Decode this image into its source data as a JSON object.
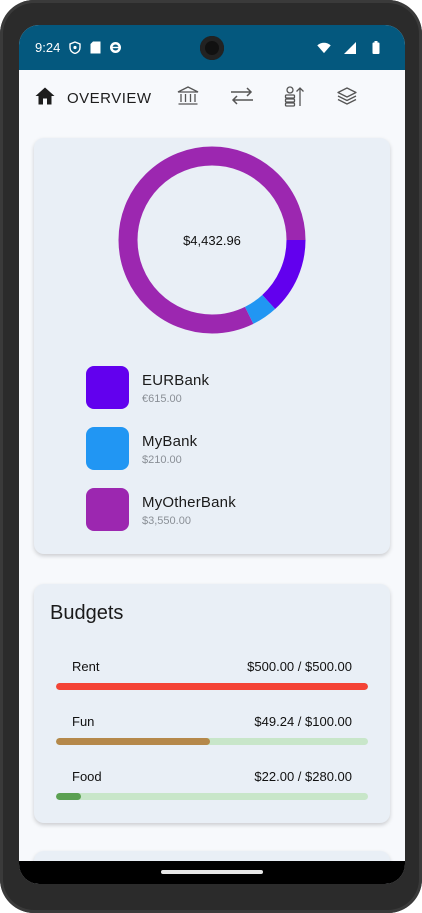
{
  "status_bar": {
    "time": "9:24",
    "left_icons": [
      "vpn-shield-icon",
      "sd-card-icon",
      "sync-icon"
    ],
    "right_icons": [
      "wifi-icon",
      "signal-icon",
      "battery-icon"
    ]
  },
  "app_bar": {
    "home_label": "OVERVIEW",
    "tabs": [
      "home-icon",
      "bank-icon",
      "transfer-icon",
      "budget-icon",
      "layers-icon"
    ]
  },
  "accounts": {
    "total": "$4,432.96",
    "items": [
      {
        "name": "EURBank",
        "amount": "€615.00",
        "color": "#6200ee",
        "share": 0.132
      },
      {
        "name": "MyBank",
        "amount": "$210.00",
        "color": "#2196f3",
        "share": 0.045
      },
      {
        "name": "MyOtherBank",
        "amount": "$3,550.00",
        "color": "#9c27b0",
        "share": 0.823
      }
    ]
  },
  "budgets": {
    "title": "Budgets",
    "items": [
      {
        "name": "Rent",
        "value": "$500.00 / $500.00",
        "progress": 1.0,
        "color": "#f44336",
        "track": "#c8e6c9"
      },
      {
        "name": "Fun",
        "value": "$49.24 / $100.00",
        "progress": 0.4924,
        "color": "#b5884a",
        "track": "#c8e6c9"
      },
      {
        "name": "Food",
        "value": "$22.00 / $280.00",
        "progress": 0.0786,
        "color": "#5ba052",
        "track": "#c8e6c9"
      }
    ]
  },
  "colors": {
    "status_bar": "#04587e",
    "card": "#e9eff6",
    "background": "#f7f9fc"
  }
}
